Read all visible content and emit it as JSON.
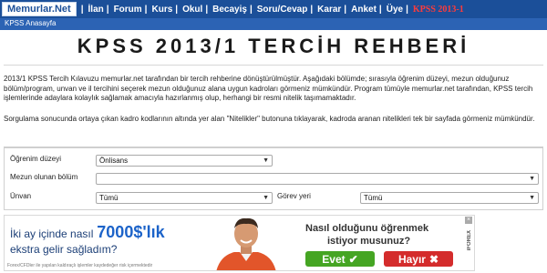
{
  "nav": {
    "brand": "Memurlar.Net",
    "items": [
      "İlan",
      "Forum",
      "Kurs",
      "Okul",
      "Becayiş",
      "Soru/Cevap",
      "Karar",
      "Anket",
      "Üye"
    ],
    "highlight": "KPSS 2013-1",
    "separator": "|"
  },
  "breadcrumb": "KPSS Anasayfa",
  "title": "KPSS 2013/1 TERCİH REHBERİ",
  "intro": "2013/1 KPSS Tercih Kılavuzu memurlar.net tarafından bir tercih rehberine dönüştürülmüştür. Aşağıdaki bölümde; sırasıyla öğrenim düzeyi, mezun olduğunuz bölüm/program, unvan ve il tercihini seçerek mezun olduğunuz alana uygun kadroları görmeniz mümkündür. Program tümüyle memurlar.net tarafından, KPSS tercih işlemlerinde adaylara kolaylık sağlamak amacıyla hazırlanmış olup, herhangi bir resmi nitelik taşımamaktadır.",
  "note": "Sorgulama sonucunda ortaya çıkan kadro kodlarının altında yer alan \"Nitelikler\" butonuna tıklayarak, kadroda aranan nitelikleri tek bir sayfada görmeniz mümkündür.",
  "form": {
    "education_label": "Öğrenim düzeyi",
    "education_value": "Önlisans",
    "department_label": "Mezun olunan bölüm",
    "department_value": "",
    "title_label": "Ünvan",
    "title_value": "Tümü",
    "location_label": "Görev yeri",
    "location_value": "Tümü"
  },
  "ad": {
    "line1_prefix": "İki ay içinde nasıl",
    "amount": "7000$'lık",
    "line2": "ekstra gelir sağladım?",
    "footer": "Forex/CFDler ile yapılan kaldıraçlı işlemler kaydedeğer risk içermektedir",
    "question1": "Nasıl olduğunu öğrenmek",
    "question2": "istiyor musunuz?",
    "yes": "Evet",
    "no": "Hayır",
    "brand": "iFOREX",
    "yes_color": "#45a523",
    "no_color": "#d42c2c"
  },
  "colors": {
    "nav_bg": "#1b4f99",
    "crumb_bg": "#2c63b4",
    "highlight": "#ff3b3b"
  }
}
